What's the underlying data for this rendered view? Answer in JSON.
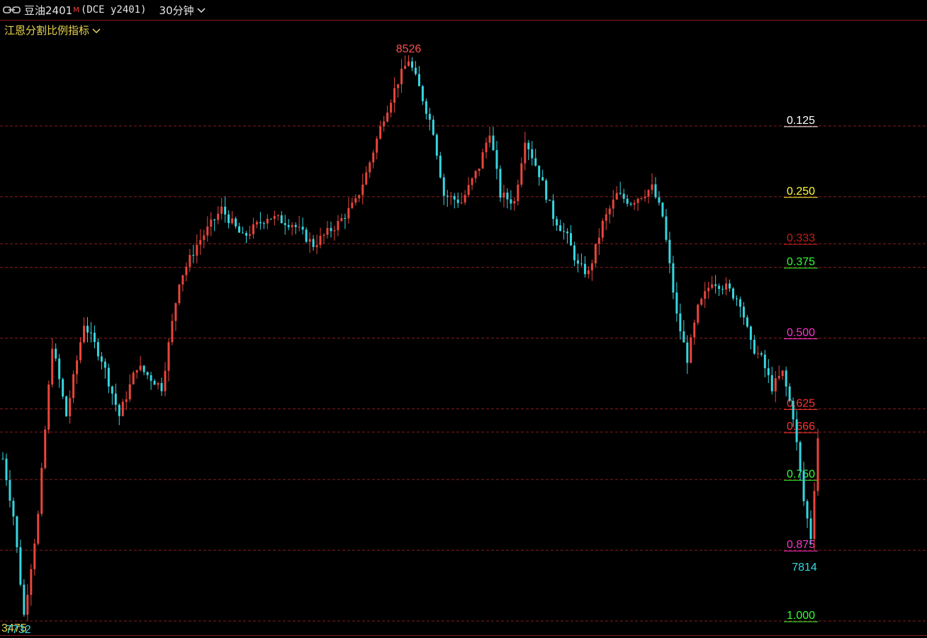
{
  "header": {
    "symbol": "豆油2401",
    "marker": "M",
    "exchange_code": "(DCE  y2401)",
    "period": "30分钟",
    "link_icon": "link-icon",
    "period_icon": "chevron-down-icon"
  },
  "indicator": {
    "name": "江恩分割比例指标",
    "icon": "chevron-down-icon"
  },
  "chart_data": {
    "type": "candlestick",
    "high_label": "8526",
    "low_label": "7732",
    "last_low_label": "7814",
    "left_partial_label": "3475",
    "colors": {
      "up": "#e8453c",
      "down": "#36d6e0",
      "grid": "#8a1c1c"
    },
    "gann_levels": [
      {
        "ratio": "0.125",
        "color": "#ffffff"
      },
      {
        "ratio": "0.250",
        "color": "#ffff33"
      },
      {
        "ratio": "0.333",
        "color": "#c41e1e"
      },
      {
        "ratio": "0.375",
        "color": "#33ff33"
      },
      {
        "ratio": "0.500",
        "color": "#ff33cc"
      },
      {
        "ratio": "0.625",
        "color": "#ff3333"
      },
      {
        "ratio": "0.666",
        "color": "#ff3333"
      },
      {
        "ratio": "0.750",
        "color": "#33ff33"
      },
      {
        "ratio": "0.875",
        "color": "#ff33cc"
      },
      {
        "ratio": "1.000",
        "color": "#33ff33"
      }
    ],
    "waypoints": [
      [
        0,
        7960
      ],
      [
        3,
        7880
      ],
      [
        6,
        7740
      ],
      [
        10,
        7880
      ],
      [
        14,
        8120
      ],
      [
        18,
        8020
      ],
      [
        23,
        8150
      ],
      [
        28,
        8100
      ],
      [
        33,
        8020
      ],
      [
        38,
        8090
      ],
      [
        45,
        8060
      ],
      [
        50,
        8210
      ],
      [
        55,
        8260
      ],
      [
        62,
        8310
      ],
      [
        68,
        8270
      ],
      [
        75,
        8300
      ],
      [
        82,
        8290
      ],
      [
        88,
        8260
      ],
      [
        95,
        8290
      ],
      [
        100,
        8320
      ],
      [
        103,
        8360
      ],
      [
        108,
        8440
      ],
      [
        112,
        8490
      ],
      [
        115,
        8520
      ],
      [
        118,
        8480
      ],
      [
        122,
        8420
      ],
      [
        125,
        8330
      ],
      [
        130,
        8320
      ],
      [
        135,
        8370
      ],
      [
        138,
        8420
      ],
      [
        141,
        8330
      ],
      [
        145,
        8320
      ],
      [
        148,
        8410
      ],
      [
        152,
        8360
      ],
      [
        156,
        8300
      ],
      [
        160,
        8270
      ],
      [
        163,
        8230
      ],
      [
        166,
        8220
      ],
      [
        170,
        8290
      ],
      [
        174,
        8330
      ],
      [
        178,
        8320
      ],
      [
        184,
        8340
      ],
      [
        187,
        8300
      ],
      [
        191,
        8160
      ],
      [
        194,
        8100
      ],
      [
        197,
        8170
      ],
      [
        201,
        8210
      ],
      [
        205,
        8200
      ],
      [
        209,
        8180
      ],
      [
        212,
        8120
      ],
      [
        215,
        8100
      ],
      [
        218,
        8060
      ],
      [
        221,
        8080
      ],
      [
        224,
        8020
      ],
      [
        227,
        7900
      ],
      [
        229,
        7850
      ],
      [
        231,
        7990
      ]
    ]
  }
}
